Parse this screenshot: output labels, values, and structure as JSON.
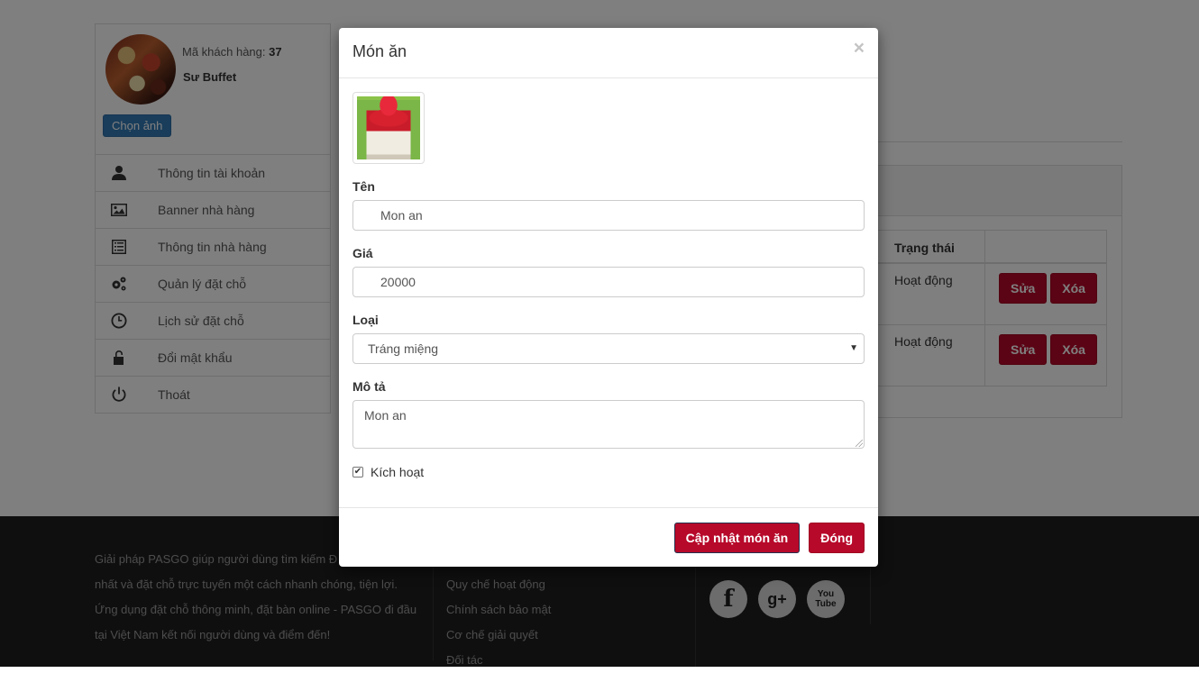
{
  "profile": {
    "customer_code_label": "Mã khách hàng:",
    "customer_code": "37",
    "name": "Sư Buffet",
    "choose_photo_label": "Chọn ảnh"
  },
  "menu": {
    "items": [
      {
        "label": "Thông tin tài khoản",
        "icon": "user-icon"
      },
      {
        "label": "Banner nhà hàng",
        "icon": "image-icon"
      },
      {
        "label": "Thông tin nhà hàng",
        "icon": "list-icon"
      },
      {
        "label": "Quản lý đặt chỗ",
        "icon": "gears-icon"
      },
      {
        "label": "Lịch sử đặt chỗ",
        "icon": "clock-icon"
      },
      {
        "label": "Đổi mật khẩu",
        "icon": "unlock-icon"
      },
      {
        "label": "Thoát",
        "icon": "power-icon"
      }
    ]
  },
  "table": {
    "status_header": "Trạng thái",
    "rows": [
      {
        "status": "Hoạt động",
        "edit_label": "Sửa",
        "delete_label": "Xóa"
      },
      {
        "status": "Hoạt động",
        "edit_label": "Sửa",
        "delete_label": "Xóa"
      }
    ]
  },
  "footer": {
    "about_lines": [
      "Giải pháp PASGO giúp người dùng tìm kiếm Đ",
      "nhất và đặt chỗ trực tuyến một cách nhanh chóng, tiện lợi.",
      "Ứng dụng đặt chỗ thông minh, đặt bàn online - PASGO đi đầu",
      "tại Việt Nam kết nối người dùng và điểm đến!"
    ],
    "links": [
      "Quy chế hoạt động",
      "Chính sách bảo mật",
      "Cơ chế giải quyết",
      "Đối tác"
    ],
    "socials": [
      {
        "icon": "facebook-icon",
        "glyph": "f"
      },
      {
        "icon": "google-plus-icon",
        "glyph": "g+"
      },
      {
        "icon": "youtube-icon",
        "glyph": "You Tube"
      }
    ]
  },
  "modal": {
    "title": "Món ăn",
    "close_glyph": "×",
    "name_label": "Tên",
    "name_value": "Mon an",
    "price_label": "Giá",
    "price_value": "20000",
    "type_label": "Loại",
    "type_value": "Tráng miệng",
    "desc_label": "Mô tả",
    "desc_value": "Mon an",
    "active_label": "Kích hoạt",
    "active_checked": true,
    "update_button": "Cập nhật món ăn",
    "close_button": "Đóng"
  },
  "colors": {
    "accent_red": "#b7092a",
    "primary_blue": "#337ab7",
    "footer_bg": "#1e1e1e"
  }
}
